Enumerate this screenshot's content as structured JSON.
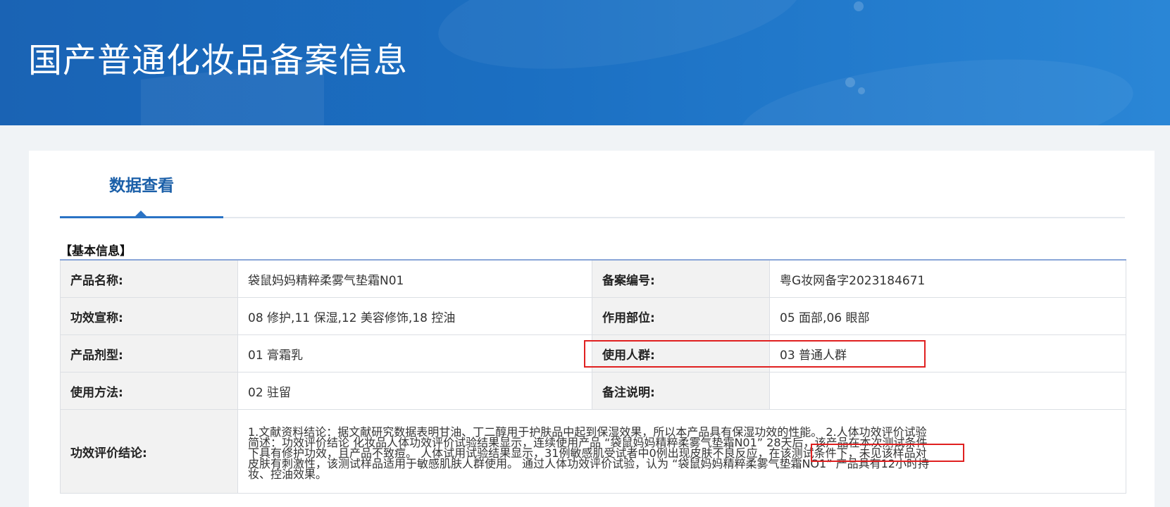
{
  "header": {
    "title": "国产普通化妆品备案信息"
  },
  "tabs": [
    {
      "label": "数据查看",
      "active": true
    }
  ],
  "section": {
    "title": "【基本信息】"
  },
  "info": {
    "product_name_label": "产品名称:",
    "product_name": "袋鼠妈妈精粹柔雾气垫霜N01",
    "record_no_label": "备案编号:",
    "record_no": "粤G妆网备字2023184671",
    "efficacy_claim_label": "功效宣称:",
    "efficacy_claim": "08 修护,11 保湿,12 美容修饰,18 控油",
    "application_area_label": "作用部位:",
    "application_area": "05 面部,06 眼部",
    "dosage_form_label": "产品剂型:",
    "dosage_form": "01 膏霜乳",
    "target_users_label": "使用人群:",
    "target_users": "03 普通人群",
    "usage_label": "使用方法:",
    "usage": "02 驻留",
    "remarks_label": "备注说明:",
    "remarks": "",
    "conclusion_label": "功效评价结论:",
    "conclusion": "1.文献资料结论：据文献研究数据表明甘油、丁二醇用于护肤品中起到保湿效果，所以本产品具有保湿功效的性能。 2.人体功效评价试验简述：功效评价结论 化妆品人体功效评价试验结果显示，连续使用产品 “袋鼠妈妈精粹柔雾气垫霜N01” 28天后，该产品在本次测试条件下具有修护功效，且产品不致痘。 人体试用试验结果显示，31例敏感肌受试者中0例出现皮肤不良反应，在该测试条件下，未见该样品对皮肤有刺激性，该测试样品适用于敏感肌肤人群使用。 通过人体功效评价试验，认为 “袋鼠妈妈精粹柔雾气垫霜NO1” 产品具有12小时持妆、控油效果。"
  },
  "annotations": {
    "highlight_color": "#e02020"
  }
}
